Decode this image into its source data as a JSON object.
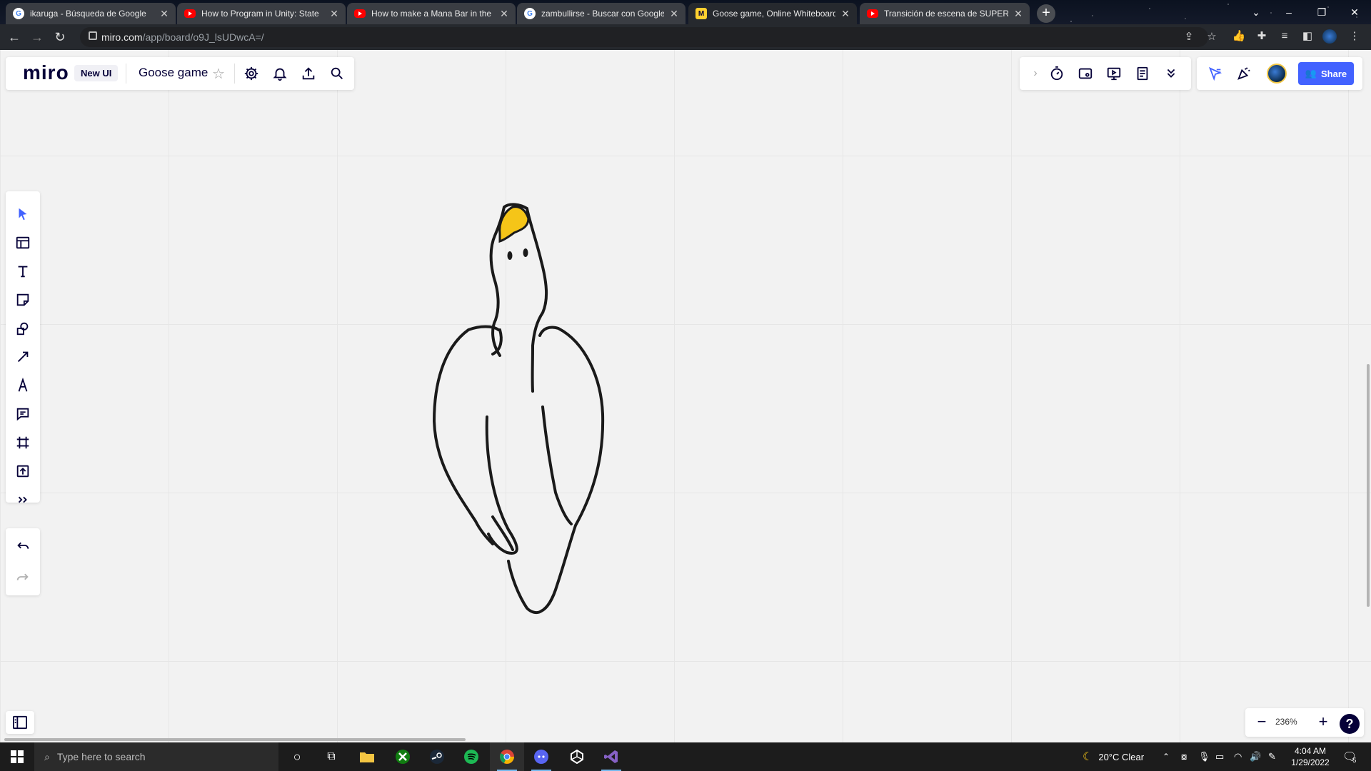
{
  "browser": {
    "tabs": [
      {
        "title": "ikaruga - Búsqueda de Google",
        "favicon": "google-icon",
        "active": false
      },
      {
        "title": "How to Program in Unity: State",
        "favicon": "youtube-icon",
        "active": false
      },
      {
        "title": "How to make a Mana Bar in the",
        "favicon": "youtube-icon",
        "active": false
      },
      {
        "title": "zambullirse - Buscar con Google",
        "favicon": "google-icon",
        "active": false
      },
      {
        "title": "Goose game, Online Whiteboard",
        "favicon": "miro-icon",
        "active": true
      },
      {
        "title": "Transición de escena de SUPER",
        "favicon": "youtube-icon",
        "active": false
      }
    ],
    "url_host": "miro.com",
    "url_path": "/app/board/o9J_lsUDwcA=/"
  },
  "miro": {
    "logo": "miro",
    "badge": "New UI",
    "board_name": "Goose game",
    "share_label": "Share",
    "zoom": "236%",
    "help": "?",
    "brand_color": "#4262ff"
  },
  "drawing": {
    "subject": "goose",
    "stroke_color": "#1a1a1a",
    "beak_color": "#f5c518"
  },
  "taskbar": {
    "search_placeholder": "Type here to search",
    "weather": "20°C  Clear",
    "time": "4:04 AM",
    "date": "1/29/2022",
    "notifications": "5"
  }
}
